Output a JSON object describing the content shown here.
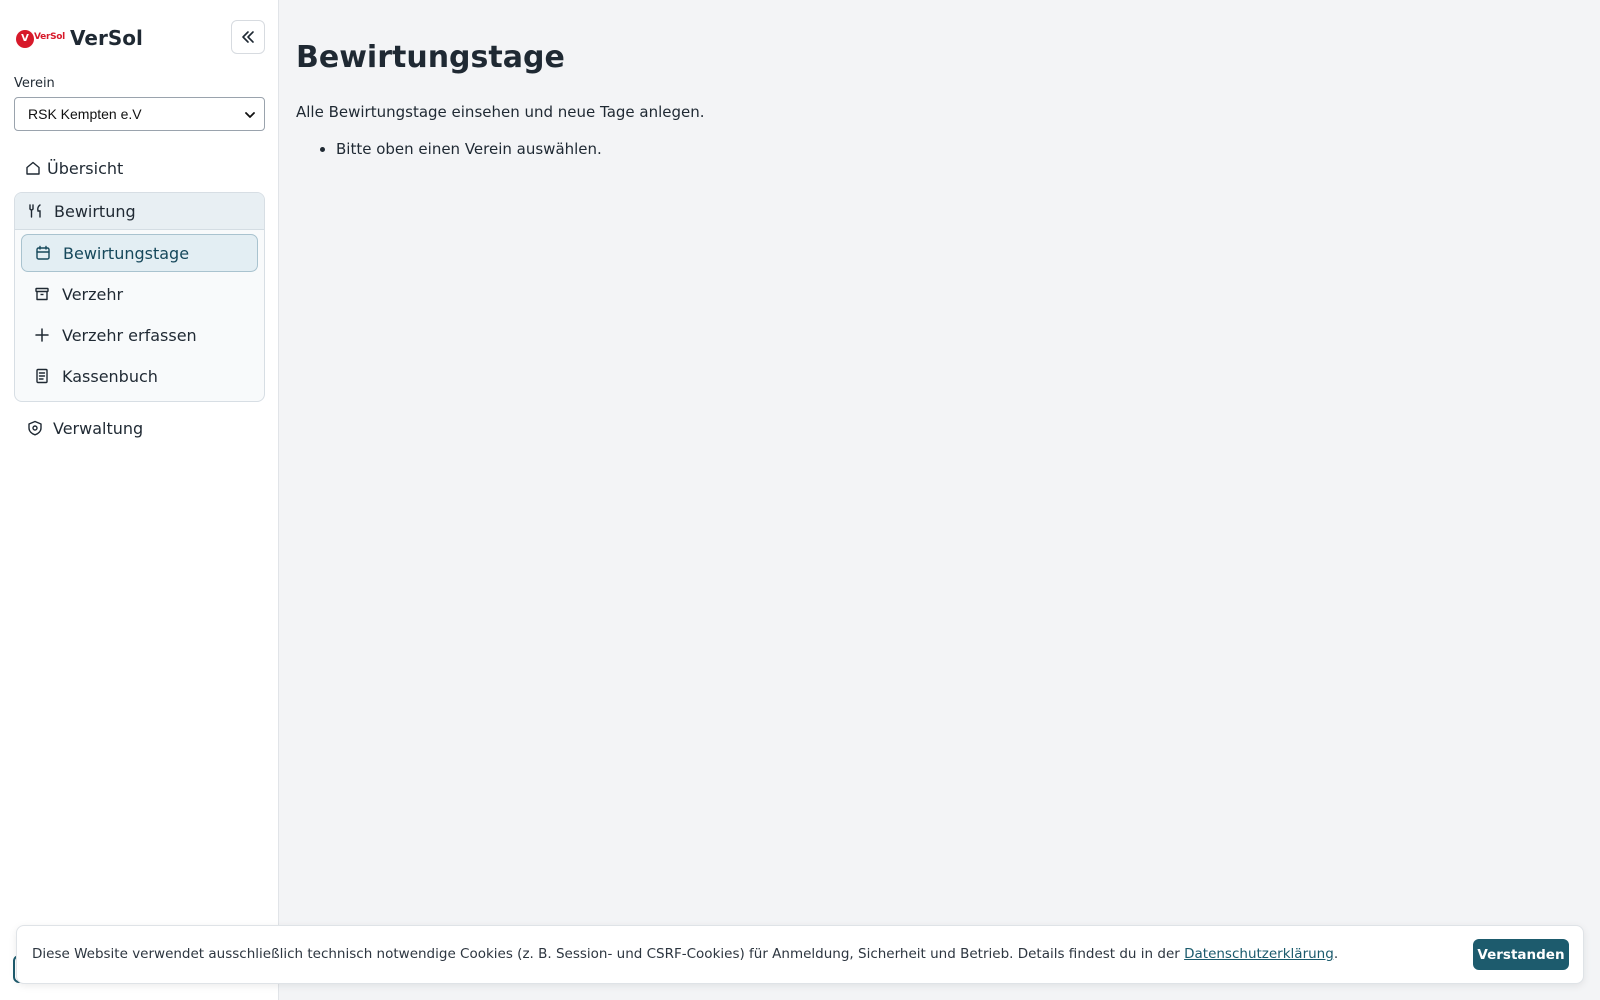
{
  "brand": {
    "logo_mark": "V",
    "logo_text": "VerSol",
    "title": "VerSol"
  },
  "sidebar": {
    "collapse_icon": "chevrons-left-icon",
    "club_label": "Verein",
    "club_selected": "RSK Kempten e.V",
    "nav": {
      "uebersicht": {
        "label": "Übersicht",
        "icon": "home-icon"
      },
      "bewirtung": {
        "label": "Bewirtung",
        "icon": "utensils-icon",
        "items": [
          {
            "label": "Bewirtungstage",
            "icon": "calendar-icon",
            "active": true
          },
          {
            "label": "Verzehr",
            "icon": "archive-icon",
            "active": false
          },
          {
            "label": "Verzehr erfassen",
            "icon": "plus-icon",
            "active": false
          },
          {
            "label": "Kassenbuch",
            "icon": "document-icon",
            "active": false
          }
        ]
      },
      "verwaltung": {
        "label": "Verwaltung",
        "icon": "shield-icon"
      }
    }
  },
  "main": {
    "title": "Bewirtungstage",
    "description": "Alle Bewirtungstage einsehen und neue Tage anlegen.",
    "hints": [
      "Bitte oben einen Verein auswählen."
    ]
  },
  "cookie_banner": {
    "text": "Diese Website verwendet ausschließlich technisch notwendige Cookies (z. B. Session- und CSRF-Cookies) für Anmeldung, Sicherheit und Betrieb. Details findest du in der ",
    "link": "Datenschutzerklärung",
    "text_end": ".",
    "button": "Verstanden"
  },
  "colors": {
    "accent": "#1d5b6d",
    "brand_red": "#d7192a",
    "background": "#f3f4f6"
  }
}
